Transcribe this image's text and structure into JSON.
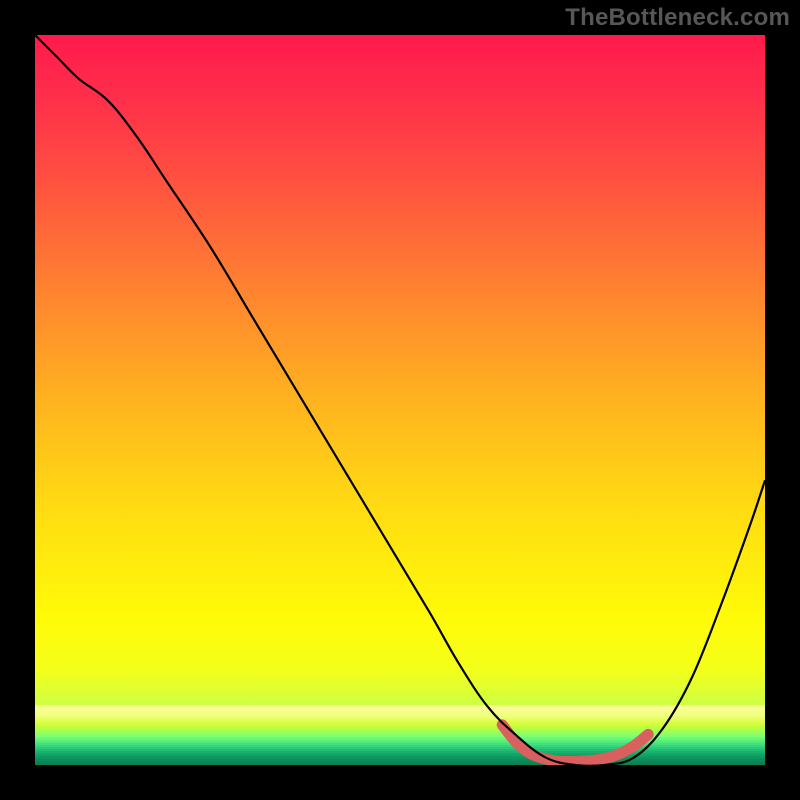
{
  "watermark": "TheBottleneck.com",
  "chart_data": {
    "type": "line",
    "title": "",
    "xlabel": "",
    "ylabel": "",
    "xlim": [
      0,
      100
    ],
    "ylim": [
      0,
      100
    ],
    "grid": false,
    "legend": false,
    "background": {
      "type": "vertical-gradient",
      "stops": [
        {
          "pos": 0.0,
          "color": "#ff1a4b"
        },
        {
          "pos": 0.08,
          "color": "#ff2d4b"
        },
        {
          "pos": 0.2,
          "color": "#ff5140"
        },
        {
          "pos": 0.35,
          "color": "#ff8330"
        },
        {
          "pos": 0.5,
          "color": "#ffb31f"
        },
        {
          "pos": 0.65,
          "color": "#ffdc12"
        },
        {
          "pos": 0.8,
          "color": "#fffb08"
        },
        {
          "pos": 0.87,
          "color": "#f4ff1a"
        },
        {
          "pos": 0.92,
          "color": "#ccff45"
        },
        {
          "pos": 0.96,
          "color": "#8dff6e"
        },
        {
          "pos": 1.0,
          "color": "#2bdd7e"
        }
      ],
      "bottom_bands": [
        "#f6ff90",
        "#f6ff90",
        "#f5ff8e",
        "#f4ff8a",
        "#f2ff82",
        "#efff76",
        "#eaff65",
        "#e3ff55",
        "#daff46",
        "#d0ff3d",
        "#c5ff3c",
        "#b8ff44",
        "#a9ff50",
        "#9aff5d",
        "#8bff69",
        "#7bff73",
        "#6cfb79",
        "#5ef37c",
        "#50ea7e",
        "#43e07e",
        "#37d57c",
        "#2cc979",
        "#22bd74",
        "#1ab26f",
        "#14a769",
        "#109e64",
        "#0e955f",
        "#0c8d5a",
        "#0b8756",
        "#0a8253"
      ]
    },
    "series": [
      {
        "name": "bottleneck-curve",
        "color": "#000000",
        "x": [
          0,
          3,
          6,
          10,
          14,
          18,
          24,
          30,
          36,
          42,
          48,
          54,
          58,
          62,
          66,
          70,
          74,
          78,
          82,
          86,
          90,
          94,
          98,
          100
        ],
        "y": [
          100,
          97,
          94,
          91,
          86,
          80,
          71,
          61,
          51,
          41,
          31,
          21,
          14,
          8,
          4,
          1,
          0,
          0,
          1,
          5,
          12,
          22,
          33,
          39
        ]
      }
    ],
    "highlight_segment": {
      "name": "optimal-range",
      "color": "#d9605e",
      "x": [
        64,
        66,
        68,
        70,
        72,
        74,
        76,
        78,
        80,
        82,
        84
      ],
      "y": [
        5.5,
        3.0,
        1.5,
        0.8,
        0.5,
        0.5,
        0.6,
        0.9,
        1.5,
        2.6,
        4.2
      ]
    }
  }
}
